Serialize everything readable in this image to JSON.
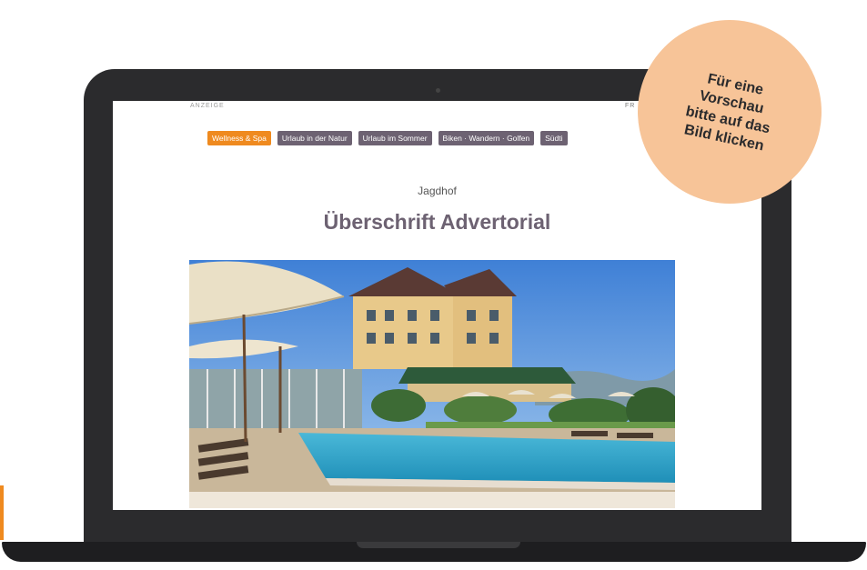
{
  "page": {
    "anzeige_label": "ANZEIGE",
    "right_label": "FR"
  },
  "nav": {
    "tabs": [
      {
        "label": "Wellness & Spa",
        "active": true
      },
      {
        "label": "Urlaub in der Natur",
        "active": false
      },
      {
        "label": "Urlaub im Sommer",
        "active": false
      },
      {
        "label": "Biken · Wandern · Golfen",
        "active": false
      },
      {
        "label": "Südti",
        "active": false
      }
    ]
  },
  "article": {
    "brand": "Jagdhof",
    "headline": "Überschrift Advertorial"
  },
  "badge": {
    "lines": [
      "Für eine",
      "Vorschau",
      "bitte auf das",
      "Bild klicken"
    ]
  },
  "colors": {
    "accent": "#ef8a1f",
    "tab_bg": "#6d6272",
    "badge_bg": "#f7c498",
    "laptop": "#2b2b2d"
  }
}
